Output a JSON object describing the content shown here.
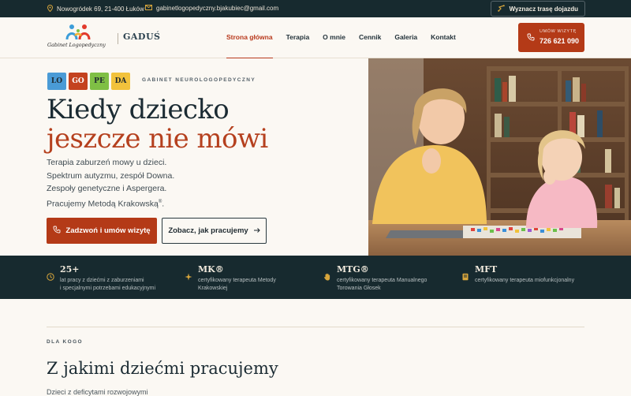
{
  "topbar": {
    "address": "Nowogródek 69, 21-400 Łuków",
    "email": "gabinetlogopedyczny.bjakubiec@gmail.com",
    "route_button": "Wyznacz trasę dojazdu"
  },
  "header": {
    "logo_text": "Gabinet Logopedyczny",
    "brand": "GADUŚ",
    "nav": [
      "Strona główna",
      "Terapia",
      "O mnie",
      "Cennik",
      "Galeria",
      "Kontakt"
    ],
    "call_small": "UMÓW WIZYTĘ",
    "call_number": "726 621 090"
  },
  "hero": {
    "tiles": [
      {
        "text": "LO",
        "color": "#4a9bd6"
      },
      {
        "text": "GO",
        "color": "#c4421f"
      },
      {
        "text": "PE",
        "color": "#7fbf45"
      },
      {
        "text": "DA",
        "color": "#f2c23c"
      }
    ],
    "tagline": "GABINET NEUROLOGOPEDYCZNY",
    "title_line1": "Kiedy dziecko",
    "title_line2": "jeszcze nie mówi",
    "desc_line1": "Terapia zaburzeń mowy u dzieci.",
    "desc_line2": "Spektrum autyzmu, zespół Downa.",
    "desc_line3": "Zespoły genetyczne i Aspergera.",
    "desc_line4": "Pracujemy Metodą Krakowską",
    "desc_sup": "®",
    "primary_button": "Zadzwoń i umów wizytę",
    "secondary_button": "Zobacz, jak pracujemy"
  },
  "stats": [
    {
      "big": "25+",
      "line1": "lat pracy z dziećmi z zaburzeniami",
      "line2": "i specjalnymi potrzebami edukacyjnymi",
      "icon": "clock-icon"
    },
    {
      "big": "MK®",
      "line1": "certyfikowany terapeuta Metody",
      "line2": "Krakowskiej",
      "icon": "sparkle-icon"
    },
    {
      "big": "MTG®",
      "line1": "certyfikowany terapeuta Manualnego",
      "line2": "Torowania Głosek",
      "icon": "hand-icon"
    },
    {
      "big": "MFT",
      "line1": "certyfikowany terapeuta miofunkcjonalny",
      "line2": "",
      "icon": "book-icon"
    }
  ],
  "section": {
    "kicker": "DLA KOGO",
    "title": "Z jakimi dziećmi pracujemy",
    "subtitle": "Dzieci z deficytami rozwojowymi"
  },
  "colors": {
    "accent": "#b43a17",
    "dark": "#172a2f",
    "gold": "#d8a63c",
    "background": "#fbf8f3"
  }
}
